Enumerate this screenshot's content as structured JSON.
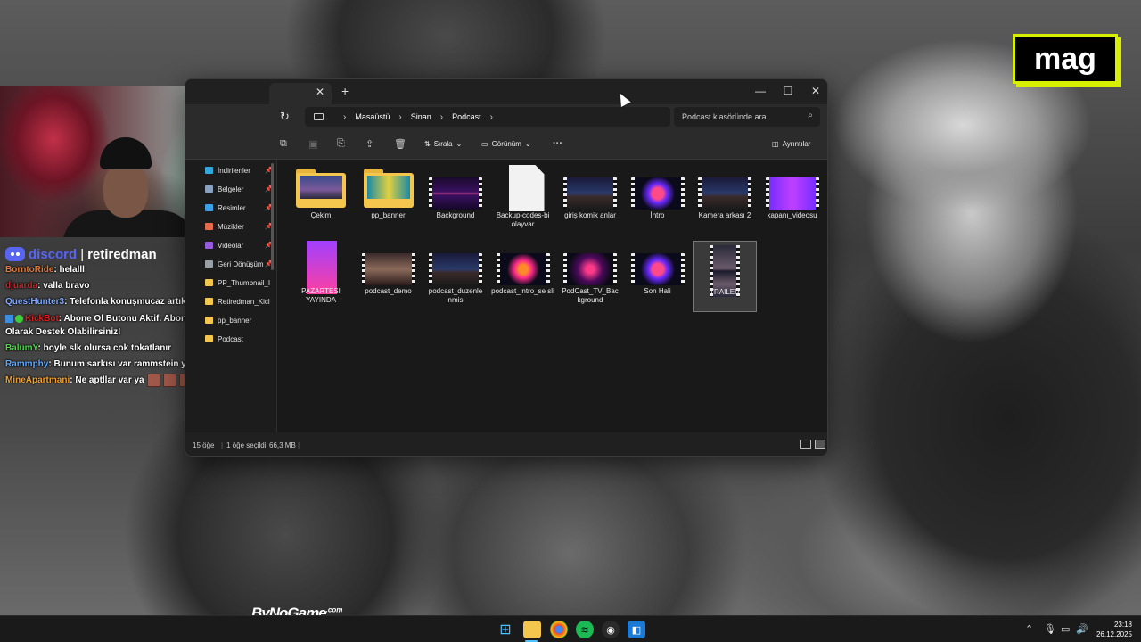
{
  "overlay": {
    "logo_text": "mag",
    "watermark_main": "ByNoGame",
    "watermark_sup": ".com"
  },
  "chat": {
    "brand": "discord",
    "separator": "|",
    "handle": "retiredman",
    "messages": [
      {
        "user": "BorntoRide",
        "color": "#e07a3c",
        "text": ": helalll"
      },
      {
        "user": "djuarda",
        "color": "#c0282e",
        "text": ": valla bravo"
      },
      {
        "user": "QuestHunter3",
        "color": "#7fa8ff",
        "text": ": Telefonla konuşmucaz artık mk"
      },
      {
        "user": "KickBot",
        "color": "#d82020",
        "text": ": Abone Ol Butonu Aktif. Abone Olarak Destek Olabilirsiniz!"
      },
      {
        "user": "BalumY",
        "color": "#4cd64c",
        "text": ": boyle slk olursa cok tokatlanır"
      },
      {
        "user": "Rammphy",
        "color": "#5fa8ff",
        "text": ": Bunum sarkısı var rammstein yaptı"
      },
      {
        "user": "MineApartmani",
        "color": "#f0a030",
        "text": ": Ne aptllar var ya"
      }
    ]
  },
  "explorer": {
    "address": {
      "crumbs": [
        "Masaüstü",
        "Sinan",
        "Podcast"
      ],
      "search_placeholder": "Podcast klasöründe ara"
    },
    "toolbar": {
      "sort_label": "Sırala",
      "view_label": "Görünüm",
      "details_label": "Ayrıntılar"
    },
    "nav": [
      {
        "label": "İndirilenler",
        "color": "#2fa8e0",
        "pinned": true
      },
      {
        "label": "Belgeler",
        "color": "#8aa0c0",
        "pinned": true
      },
      {
        "label": "Resimler",
        "color": "#3aa0e8",
        "pinned": true
      },
      {
        "label": "Müzikler",
        "color": "#e86a4a",
        "pinned": true
      },
      {
        "label": "Videolar",
        "color": "#9a5ae0",
        "pinned": true
      },
      {
        "label": "Geri Dönüşüm",
        "color": "#9aa0a8",
        "pinned": true
      },
      {
        "label": "PP_Thumbnail_I",
        "color": "#f4c64e",
        "pinned": false
      },
      {
        "label": "Retiredman_Kicl",
        "color": "#f4c64e",
        "pinned": false
      },
      {
        "label": "pp_banner",
        "color": "#f4c64e",
        "pinned": false
      },
      {
        "label": "Podcast",
        "color": "#f4c64e",
        "pinned": false
      }
    ],
    "files": [
      {
        "name": "Çekim",
        "kind": "folder"
      },
      {
        "name": "pp_banner",
        "kind": "folder"
      },
      {
        "name": "Background",
        "kind": "video"
      },
      {
        "name": "Backup-codes-bi olayvar",
        "kind": "document"
      },
      {
        "name": "giriş komik anlar",
        "kind": "video"
      },
      {
        "name": "İntro",
        "kind": "video"
      },
      {
        "name": "Kamera arkası 2",
        "kind": "video"
      },
      {
        "name": "kapanı_videosu",
        "kind": "video"
      },
      {
        "name": "PAZARTESI YAYINDA",
        "kind": "image"
      },
      {
        "name": "podcast_demo",
        "kind": "video"
      },
      {
        "name": "podcast_duzenle nmis",
        "kind": "video"
      },
      {
        "name": "podcast_intro_se sli",
        "kind": "video"
      },
      {
        "name": "PodCast_TV_Bac kground",
        "kind": "video"
      },
      {
        "name": "Son Hali",
        "kind": "video"
      },
      {
        "name": "TRAILER",
        "kind": "video",
        "selected": true
      }
    ],
    "status": {
      "count": "15 öğe",
      "selection": "1 öğe seçildi",
      "size": "66,3 MB"
    }
  },
  "taskbar": {
    "time": "23:18",
    "date": "26.12.2025"
  }
}
